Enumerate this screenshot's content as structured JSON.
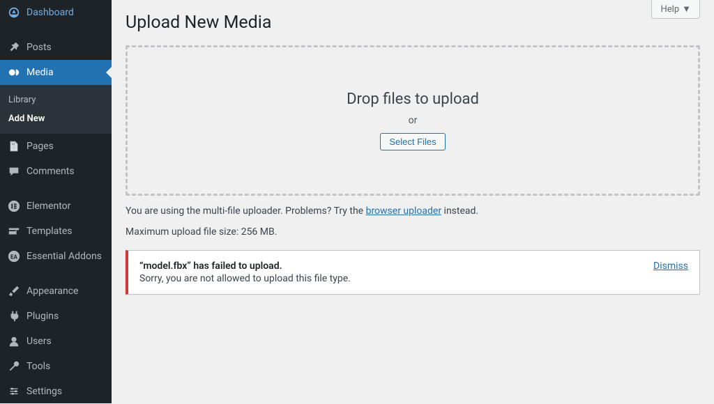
{
  "sidebar": {
    "items": [
      {
        "label": "Dashboard",
        "icon": "dashboard"
      },
      {
        "label": "Posts",
        "icon": "pin"
      },
      {
        "label": "Media",
        "icon": "media",
        "active": true
      },
      {
        "label": "Pages",
        "icon": "pages"
      },
      {
        "label": "Comments",
        "icon": "comments"
      },
      {
        "label": "Elementor",
        "icon": "elementor"
      },
      {
        "label": "Templates",
        "icon": "templates"
      },
      {
        "label": "Essential Addons",
        "icon": "ea"
      },
      {
        "label": "Appearance",
        "icon": "brush"
      },
      {
        "label": "Plugins",
        "icon": "plug"
      },
      {
        "label": "Users",
        "icon": "user"
      },
      {
        "label": "Tools",
        "icon": "wrench"
      },
      {
        "label": "Settings",
        "icon": "gear"
      }
    ],
    "sub": {
      "library": "Library",
      "add_new": "Add New"
    }
  },
  "header": {
    "help": "Help"
  },
  "page": {
    "title": "Upload New Media"
  },
  "drop": {
    "title": "Drop files to upload",
    "or": "or",
    "select": "Select Files"
  },
  "info": {
    "prefix": "You are using the multi-file uploader. Problems? Try the ",
    "link": "browser uploader",
    "suffix": " instead."
  },
  "max": "Maximum upload file size: 256 MB.",
  "error": {
    "title": "“model.fbx” has failed to upload.",
    "message": "Sorry, you are not allowed to upload this file type.",
    "dismiss": "Dismiss"
  }
}
